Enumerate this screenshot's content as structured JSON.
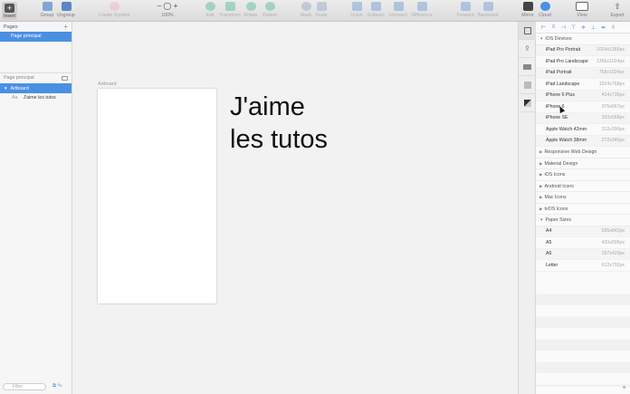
{
  "toolbar": {
    "insert": "Insert",
    "group": "Group",
    "ungroup": "Ungroup",
    "create_symbol": "Create Symbol",
    "zoom": "100%",
    "edit": "Edit",
    "transform": "Transform",
    "rotate": "Rotate",
    "flatten": "Flatten",
    "mask": "Mask",
    "scale": "Scale",
    "union": "Union",
    "subtract": "Subtract",
    "intersect": "Intersect",
    "difference": "Difference",
    "forward": "Forward",
    "backward": "Backward",
    "mirror": "Mirror",
    "cloud": "Cloud",
    "view": "View",
    "export": "Export"
  },
  "pages": {
    "title": "Pages",
    "add": "+",
    "selected_page": "Page principal"
  },
  "layers": {
    "page_label": "Page principal",
    "artboard": "Artboard",
    "text_layer_icon": "Aa",
    "text_layer": "J'aime les tutos"
  },
  "filter": {
    "placeholder": "Filter"
  },
  "canvas": {
    "artboard_label": "Artboard",
    "text_line1": "J'aime",
    "text_line2": "les tutos"
  },
  "presets": {
    "ios_devices_title": "iOS Devices",
    "ios_devices": [
      {
        "name": "iPad Pro Portrait",
        "size": "1024x1366px"
      },
      {
        "name": "iPad Pro Landscape",
        "size": "1366x1024px"
      },
      {
        "name": "iPad Portrait",
        "size": "768x1024px"
      },
      {
        "name": "iPad Landscape",
        "size": "1024x768px"
      },
      {
        "name": "iPhone 6 Plus",
        "size": "414x736px"
      },
      {
        "name": "iPhone 6",
        "size": "375x667px"
      },
      {
        "name": "iPhone SE",
        "size": "320x568px"
      },
      {
        "name": "Apple Watch 42mm",
        "size": "312x390px"
      },
      {
        "name": "Apple Watch 38mm",
        "size": "272x340px"
      }
    ],
    "collapsed": [
      "Responsive Web Design",
      "Material Design",
      "iOS Icons",
      "Android Icons",
      "Mac Icons",
      "tvOS Icons"
    ],
    "paper_title": "Paper Sizes",
    "paper": [
      {
        "name": "A4",
        "size": "595x842px"
      },
      {
        "name": "A5",
        "size": "420x595px"
      },
      {
        "name": "A6",
        "size": "297x420px"
      },
      {
        "name": "Letter",
        "size": "612x792px"
      }
    ]
  },
  "colors": {
    "accent": "#4a90e2"
  }
}
